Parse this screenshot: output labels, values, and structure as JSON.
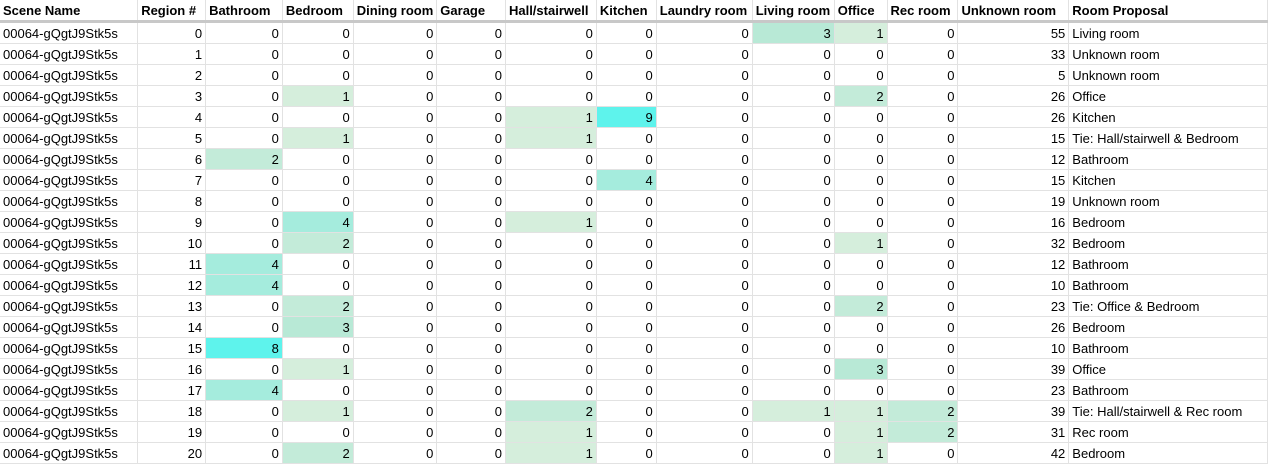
{
  "columns": [
    "Scene Name",
    "Region #",
    "Bathroom",
    "Bedroom",
    "Dining room",
    "Garage",
    "Hall/stairwell",
    "Kitchen",
    "Laundry room",
    "Living room",
    "Office",
    "Rec room",
    "Unknown room",
    "Room Proposal"
  ],
  "heat_colors": {
    "1": "#d5eedc",
    "2": "#c3ebd9",
    "3": "#b8e9d6",
    "4": "#a5ecdd",
    "8": "#5ef3ec",
    "9": "#5ef3ec"
  },
  "rows": [
    {
      "scene": "00064-gQgtJ9Stk5s",
      "region": 0,
      "counts": [
        0,
        0,
        0,
        0,
        0,
        0,
        0,
        3,
        1,
        0
      ],
      "unknown": 55,
      "proposal": "Living room"
    },
    {
      "scene": "00064-gQgtJ9Stk5s",
      "region": 1,
      "counts": [
        0,
        0,
        0,
        0,
        0,
        0,
        0,
        0,
        0,
        0
      ],
      "unknown": 33,
      "proposal": "Unknown room"
    },
    {
      "scene": "00064-gQgtJ9Stk5s",
      "region": 2,
      "counts": [
        0,
        0,
        0,
        0,
        0,
        0,
        0,
        0,
        0,
        0
      ],
      "unknown": 5,
      "proposal": "Unknown room"
    },
    {
      "scene": "00064-gQgtJ9Stk5s",
      "region": 3,
      "counts": [
        0,
        1,
        0,
        0,
        0,
        0,
        0,
        0,
        2,
        0
      ],
      "unknown": 26,
      "proposal": "Office"
    },
    {
      "scene": "00064-gQgtJ9Stk5s",
      "region": 4,
      "counts": [
        0,
        0,
        0,
        0,
        1,
        9,
        0,
        0,
        0,
        0
      ],
      "unknown": 26,
      "proposal": "Kitchen"
    },
    {
      "scene": "00064-gQgtJ9Stk5s",
      "region": 5,
      "counts": [
        0,
        1,
        0,
        0,
        1,
        0,
        0,
        0,
        0,
        0
      ],
      "unknown": 15,
      "proposal": "Tie: Hall/stairwell & Bedroom"
    },
    {
      "scene": "00064-gQgtJ9Stk5s",
      "region": 6,
      "counts": [
        2,
        0,
        0,
        0,
        0,
        0,
        0,
        0,
        0,
        0
      ],
      "unknown": 12,
      "proposal": "Bathroom"
    },
    {
      "scene": "00064-gQgtJ9Stk5s",
      "region": 7,
      "counts": [
        0,
        0,
        0,
        0,
        0,
        4,
        0,
        0,
        0,
        0
      ],
      "unknown": 15,
      "proposal": "Kitchen"
    },
    {
      "scene": "00064-gQgtJ9Stk5s",
      "region": 8,
      "counts": [
        0,
        0,
        0,
        0,
        0,
        0,
        0,
        0,
        0,
        0
      ],
      "unknown": 19,
      "proposal": "Unknown room"
    },
    {
      "scene": "00064-gQgtJ9Stk5s",
      "region": 9,
      "counts": [
        0,
        4,
        0,
        0,
        1,
        0,
        0,
        0,
        0,
        0
      ],
      "unknown": 16,
      "proposal": "Bedroom"
    },
    {
      "scene": "00064-gQgtJ9Stk5s",
      "region": 10,
      "counts": [
        0,
        2,
        0,
        0,
        0,
        0,
        0,
        0,
        1,
        0
      ],
      "unknown": 32,
      "proposal": "Bedroom"
    },
    {
      "scene": "00064-gQgtJ9Stk5s",
      "region": 11,
      "counts": [
        4,
        0,
        0,
        0,
        0,
        0,
        0,
        0,
        0,
        0
      ],
      "unknown": 12,
      "proposal": "Bathroom"
    },
    {
      "scene": "00064-gQgtJ9Stk5s",
      "region": 12,
      "counts": [
        4,
        0,
        0,
        0,
        0,
        0,
        0,
        0,
        0,
        0
      ],
      "unknown": 10,
      "proposal": "Bathroom"
    },
    {
      "scene": "00064-gQgtJ9Stk5s",
      "region": 13,
      "counts": [
        0,
        2,
        0,
        0,
        0,
        0,
        0,
        0,
        2,
        0
      ],
      "unknown": 23,
      "proposal": "Tie: Office & Bedroom"
    },
    {
      "scene": "00064-gQgtJ9Stk5s",
      "region": 14,
      "counts": [
        0,
        3,
        0,
        0,
        0,
        0,
        0,
        0,
        0,
        0
      ],
      "unknown": 26,
      "proposal": "Bedroom"
    },
    {
      "scene": "00064-gQgtJ9Stk5s",
      "region": 15,
      "counts": [
        8,
        0,
        0,
        0,
        0,
        0,
        0,
        0,
        0,
        0
      ],
      "unknown": 10,
      "proposal": "Bathroom"
    },
    {
      "scene": "00064-gQgtJ9Stk5s",
      "region": 16,
      "counts": [
        0,
        1,
        0,
        0,
        0,
        0,
        0,
        0,
        3,
        0
      ],
      "unknown": 39,
      "proposal": "Office"
    },
    {
      "scene": "00064-gQgtJ9Stk5s",
      "region": 17,
      "counts": [
        4,
        0,
        0,
        0,
        0,
        0,
        0,
        0,
        0,
        0
      ],
      "unknown": 23,
      "proposal": "Bathroom"
    },
    {
      "scene": "00064-gQgtJ9Stk5s",
      "region": 18,
      "counts": [
        0,
        1,
        0,
        0,
        2,
        0,
        0,
        1,
        1,
        2
      ],
      "unknown": 39,
      "proposal": "Tie: Hall/stairwell & Rec room"
    },
    {
      "scene": "00064-gQgtJ9Stk5s",
      "region": 19,
      "counts": [
        0,
        0,
        0,
        0,
        1,
        0,
        0,
        0,
        1,
        2
      ],
      "unknown": 31,
      "proposal": "Rec room"
    },
    {
      "scene": "00064-gQgtJ9Stk5s",
      "region": 20,
      "counts": [
        0,
        2,
        0,
        0,
        1,
        0,
        0,
        0,
        1,
        0
      ],
      "unknown": 42,
      "proposal": "Bedroom"
    }
  ]
}
